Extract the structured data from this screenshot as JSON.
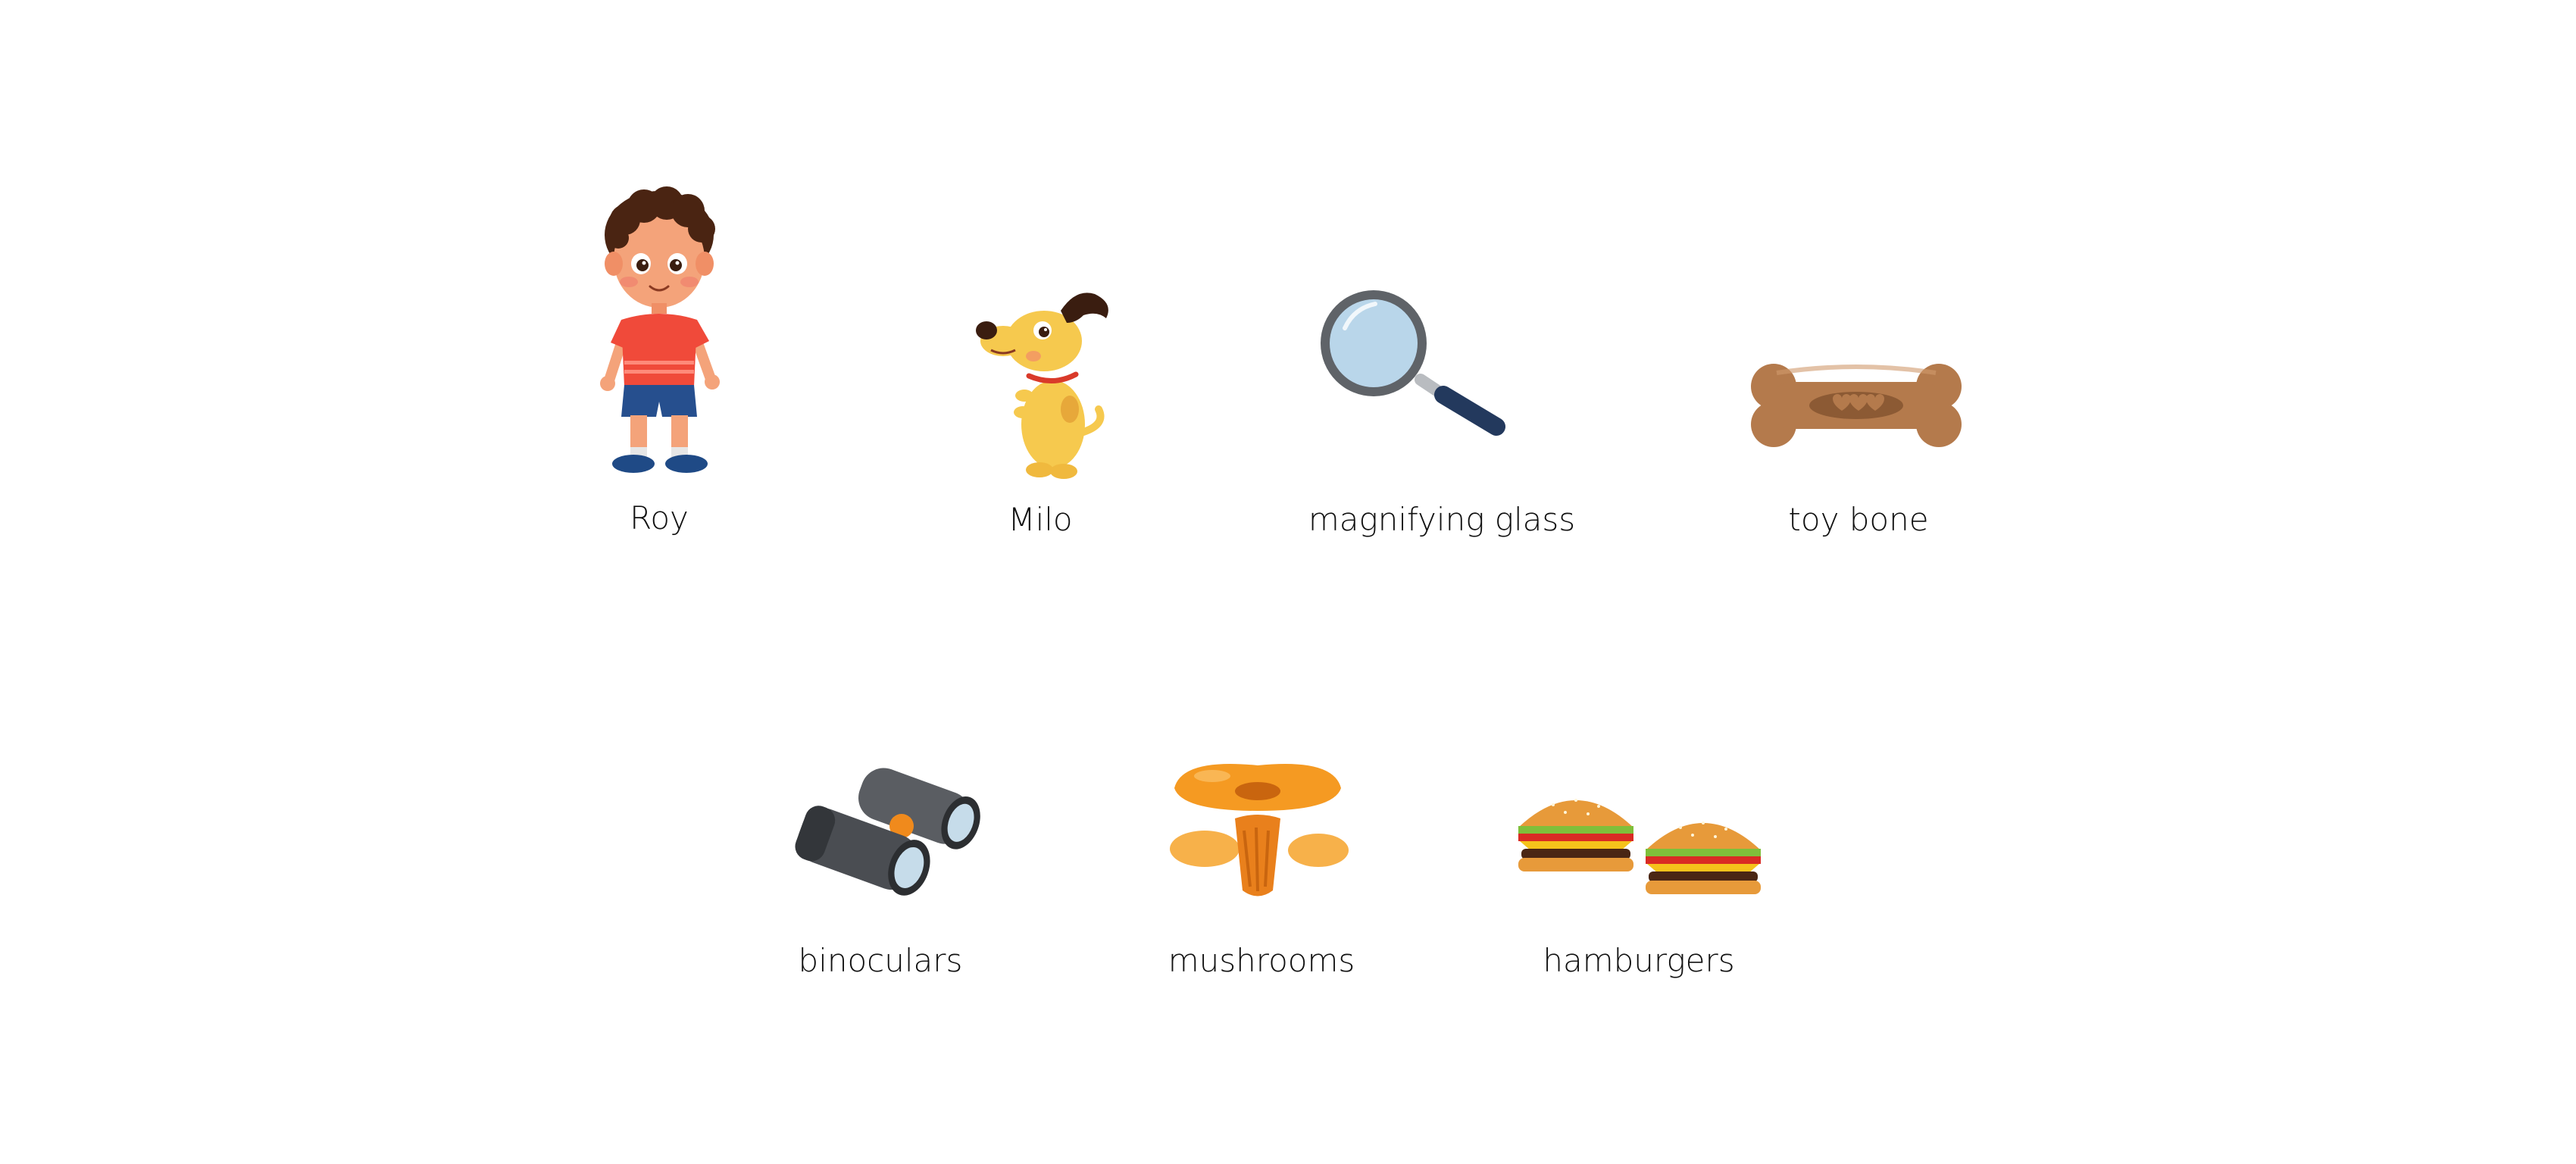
{
  "row1": {
    "roy": {
      "label": "Roy",
      "icon": "boy-icon"
    },
    "milo": {
      "label": "Milo",
      "icon": "dog-icon"
    },
    "magnifier": {
      "label": "magnifying glass",
      "icon": "magnifying-glass-icon"
    },
    "bone": {
      "label": "toy bone",
      "icon": "toy-bone-icon"
    }
  },
  "row2": {
    "binoculars": {
      "label": "binoculars",
      "icon": "binoculars-icon"
    },
    "mushrooms": {
      "label": "mushrooms",
      "icon": "mushrooms-icon"
    },
    "hamburgers": {
      "label": "hamburgers",
      "icon": "hamburgers-icon"
    }
  },
  "colors": {
    "background": "#ffffff",
    "text": "#111111",
    "shirt": "#f04a3a",
    "shorts": "#264f8e",
    "dog": "#f6c94e",
    "lens": "#b9d6ea",
    "bone": "#b47a4c",
    "binoculars": "#4a4d52",
    "mushroom": "#f59a22",
    "bun": "#e79a3a"
  }
}
